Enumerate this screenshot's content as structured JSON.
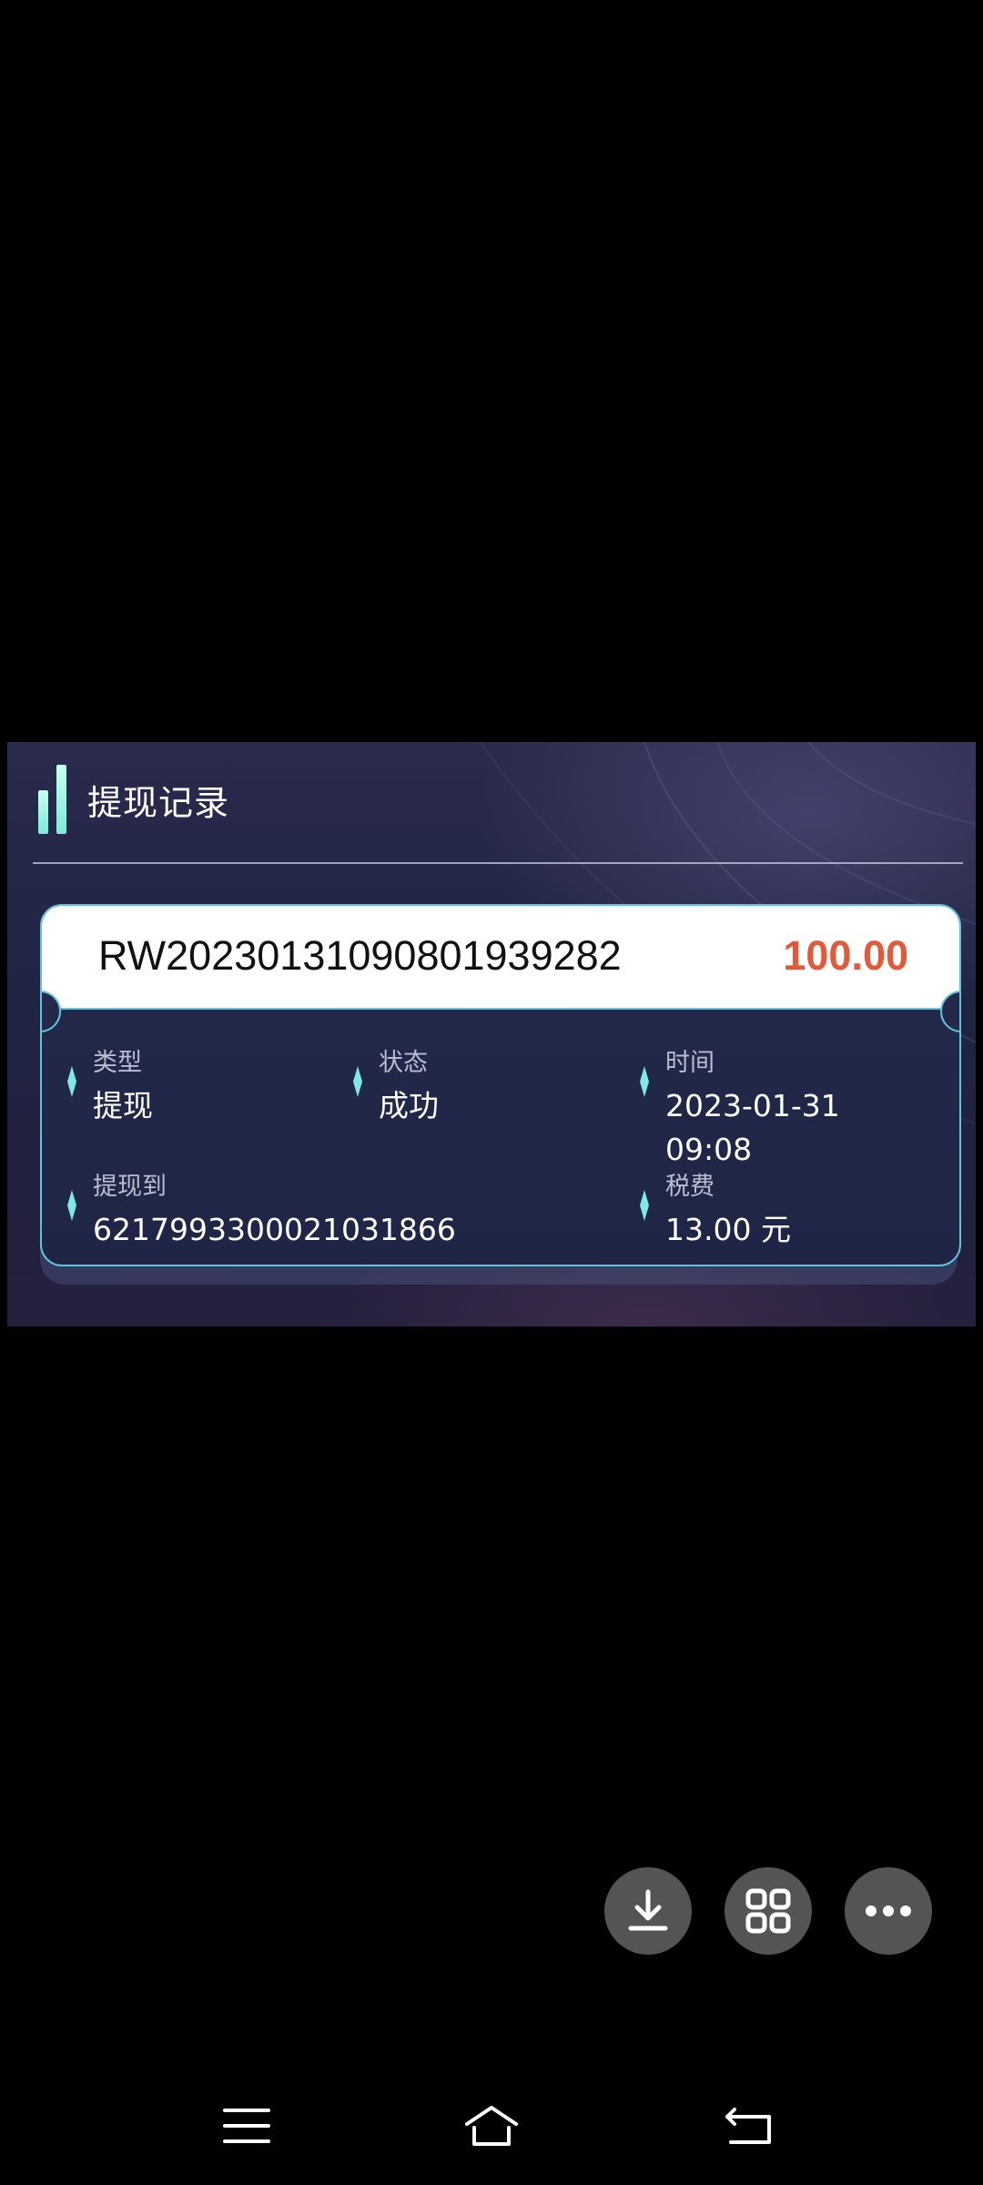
{
  "panel": {
    "title": "提现记录"
  },
  "record": {
    "order_no": "RW20230131090801939282",
    "amount": "100.00",
    "type_label": "类型",
    "type_value": "提现",
    "status_label": "状态",
    "status_value": "成功",
    "time_label": "时间",
    "time_date": "2023-01-31",
    "time_clock": "09:08",
    "withdraw_to_label": "提现到",
    "withdraw_to_value": "6217993300021031866",
    "tax_label": "税费",
    "tax_value": "13.00 元"
  },
  "fabs": [
    "download-icon",
    "grid-icon",
    "more-icon"
  ],
  "nav": [
    "menu-icon",
    "home-icon",
    "back-icon"
  ],
  "colors": {
    "accent_cyan": "#5fc3de",
    "amount_red": "#e25a3a",
    "title_bar_green": "#7fe9d8"
  }
}
